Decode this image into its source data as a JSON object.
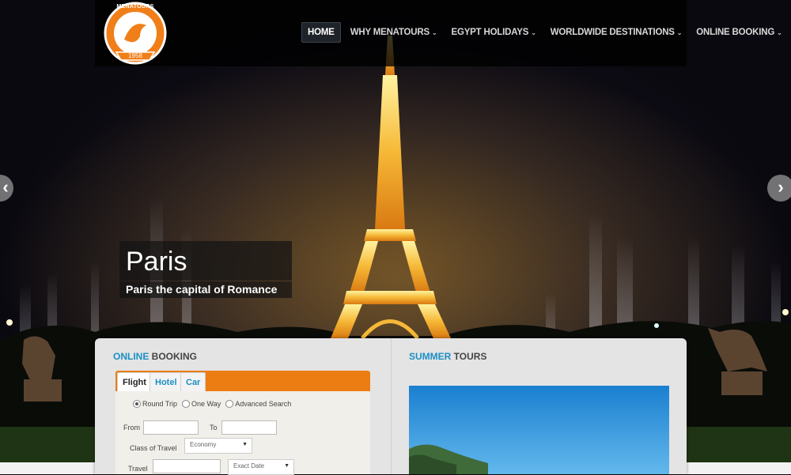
{
  "logo": {
    "top_text": "MENATOURS",
    "year": "1958",
    "color": "#f07f1a"
  },
  "nav": {
    "items": [
      {
        "label": "HOME",
        "active": true
      },
      {
        "label": "WHY MENATOURS",
        "dropdown": true
      },
      {
        "label": "EGYPT HOLIDAYS",
        "dropdown": true
      },
      {
        "label": "WORLDWIDE DESTINATIONS",
        "dropdown": true
      },
      {
        "label": "ONLINE BOOKING",
        "dropdown": true
      }
    ]
  },
  "slider": {
    "title": "Paris",
    "subtitle": "Paris the capital of Romance",
    "prev_icon": "chevron-left-icon",
    "next_icon": "chevron-right-icon"
  },
  "booking": {
    "title_highlight": "ONLINE",
    "title_rest": " BOOKING",
    "tabs": [
      "Flight",
      "Hotel",
      "Car"
    ],
    "trip_types": [
      {
        "label": "Round Trip",
        "selected": true
      },
      {
        "label": "One Way",
        "selected": false
      },
      {
        "label": "Advanced Search",
        "selected": false
      }
    ],
    "from_label": "From",
    "to_label": "To",
    "class_label": "Class of Travel",
    "class_value": "Economy",
    "travel_label": "Travel",
    "date_option": "Exact Date",
    "accent_color": "#ec7d13"
  },
  "tours": {
    "title_highlight": "SUMMER",
    "title_rest": " TOURS"
  }
}
